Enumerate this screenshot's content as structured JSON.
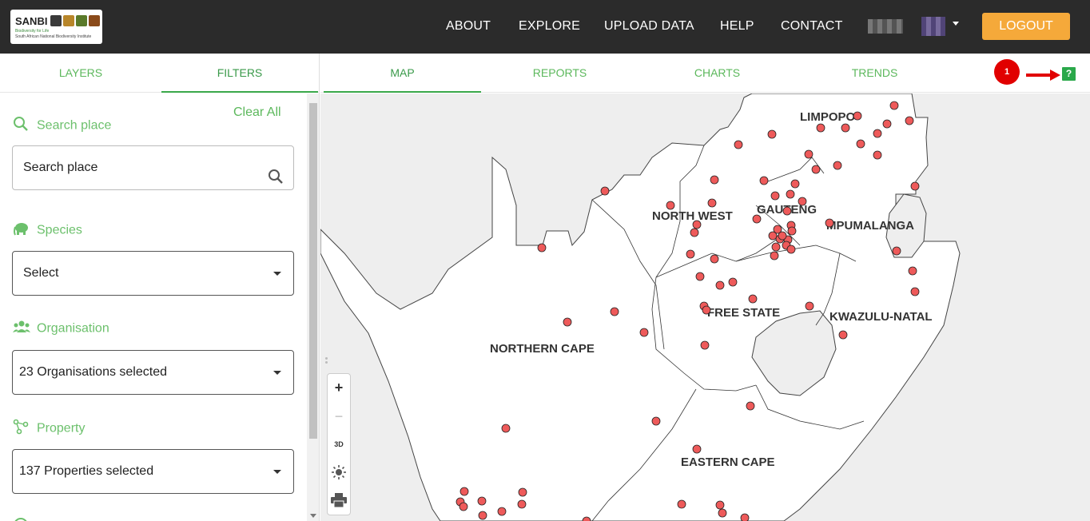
{
  "header": {
    "logo": {
      "brand": "SANBI",
      "line1": "Biodiversity for Life",
      "line2": "South African National Biodiversity Institute"
    },
    "nav": [
      "ABOUT",
      "EXPLORE",
      "UPLOAD DATA",
      "HELP",
      "CONTACT"
    ],
    "logout_label": "LOGOUT",
    "colors": {
      "bar": "#2b2b2b",
      "logout": "#f5a93a"
    }
  },
  "left_tabs": [
    "LAYERS",
    "FILTERS"
  ],
  "filters": {
    "clear_all": "Clear All",
    "search_place": {
      "label": "Search place",
      "placeholder": "Search place"
    },
    "species": {
      "label": "Species",
      "value": "Select"
    },
    "organisation": {
      "label": "Organisation",
      "value": "23 Organisations selected"
    },
    "property": {
      "label": "Property",
      "value": "137 Properties selected"
    }
  },
  "right_tabs": [
    "MAP",
    "REPORTS",
    "CHARTS",
    "TRENDS"
  ],
  "annotation": {
    "badge": "1",
    "help": "?"
  },
  "map": {
    "provinces": [
      "LIMPOPO",
      "NORTH WEST",
      "GAUTENG",
      "MPUMALANGA",
      "FREE STATE",
      "KWAZULU-NATAL",
      "NORTHERN CAPE",
      "EASTERN CAPE"
    ],
    "controls": {
      "zoom_in": "+",
      "zoom_out": "−",
      "three_d": "3D"
    },
    "colors": {
      "point": "#ee5a5a",
      "land": "#ffffff",
      "neighbor": "#eeeeee"
    }
  }
}
